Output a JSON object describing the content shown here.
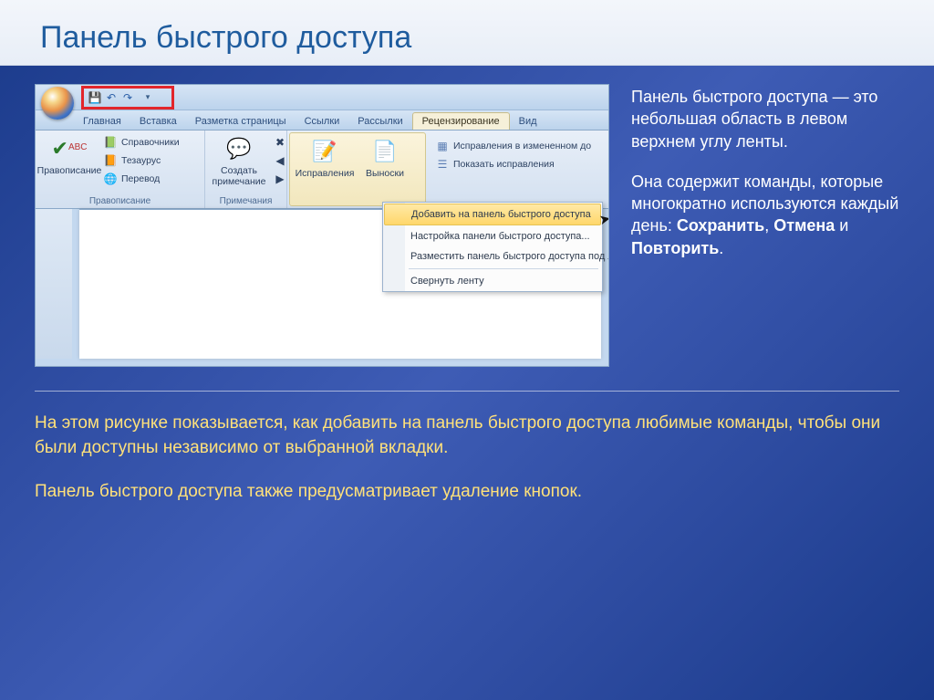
{
  "slide": {
    "title": "Панель быстрого доступа"
  },
  "word": {
    "qat": {
      "save": "💾",
      "undo": "↶",
      "redo": "↷",
      "dropdown": "▾"
    },
    "tabs": {
      "home": "Главная",
      "insert": "Вставка",
      "layout": "Разметка страницы",
      "refs": "Ссылки",
      "mail": "Рассылки",
      "review": "Рецензирование",
      "view": "Вид"
    },
    "ribbon": {
      "spelling_group": "Правописание",
      "spelling_btn": "Правописание",
      "research": "Справочники",
      "thesaurus": "Тезаурус",
      "translate": "Перевод",
      "comments_group": "Примечания",
      "new_comment": "Создать примечание",
      "tracking_btn": "Исправления",
      "balloons_btn": "Выноски",
      "markup1": "Исправления в измененном до",
      "markup2": "Показать исправления"
    },
    "context_menu": {
      "add": "Добавить на панель быстрого доступа",
      "customize": "Настройка панели быстрого доступа...",
      "below": "Разместить панель быстрого доступа под лентой",
      "minimize": "Свернуть ленту"
    }
  },
  "sidetext": {
    "p1": "Панель быстрого доступа — это небольшая область в левом верхнем углу ленты.",
    "p2a": "Она содержит команды, которые многократно используются каждый день: ",
    "p2_save": "Сохранить",
    "p2_sep1": ", ",
    "p2_undo": "Отмена",
    "p2_sep2": " и ",
    "p2_redo": "Повторить",
    "p2_end": "."
  },
  "bottom": {
    "p1": "На этом рисунке показывается, как добавить на панель быстрого доступа любимые команды, чтобы они были доступны независимо от выбранной вкладки.",
    "p2": "Панель быстрого доступа также предусматривает удаление кнопок."
  }
}
